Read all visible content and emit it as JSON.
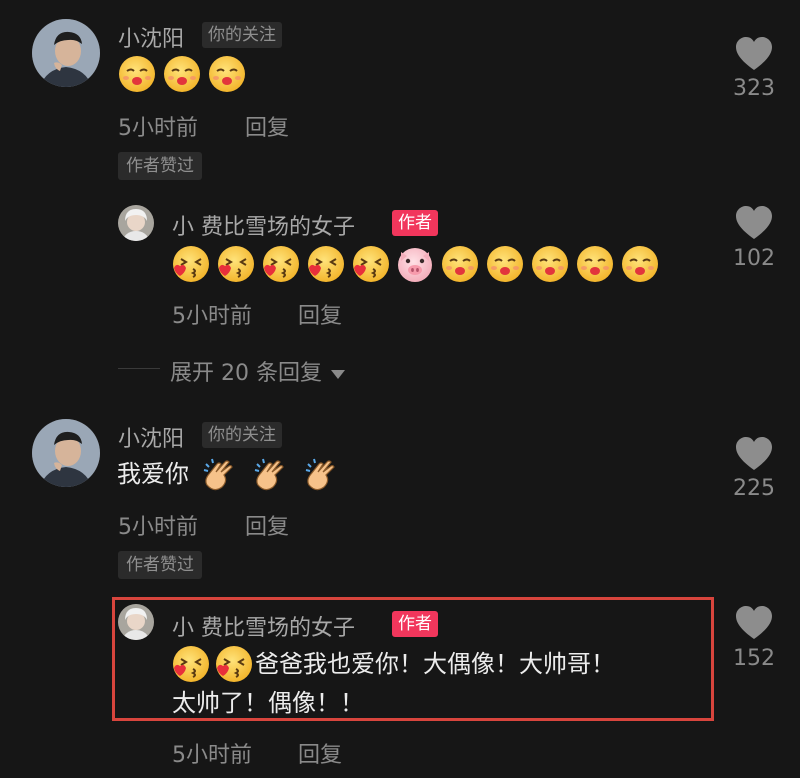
{
  "comments": [
    {
      "username": "小沈阳",
      "tag": "你的关注",
      "emojis": [
        "kiss-emoji",
        "kiss-emoji",
        "kiss-emoji"
      ],
      "time": "5小时前",
      "reply_label": "回复",
      "author_liked": "作者赞过",
      "likes": "323",
      "reply": {
        "username": "小 费比雪场的女子",
        "tag": "作者",
        "emojis": [
          "blow-kiss-emoji",
          "blow-kiss-emoji",
          "blow-kiss-emoji",
          "blow-kiss-emoji",
          "blow-kiss-emoji",
          "pig-emoji",
          "kiss-emoji",
          "kiss-emoji",
          "kiss-emoji",
          "kiss-emoji",
          "kiss-emoji"
        ],
        "time": "5小时前",
        "reply_label": "回复",
        "likes": "102"
      },
      "expand_label": "展开 20 条回复"
    },
    {
      "username": "小沈阳",
      "tag": "你的关注",
      "text": "我爱你",
      "emojis": [
        "clap-emoji",
        "clap-emoji",
        "clap-emoji"
      ],
      "time": "5小时前",
      "reply_label": "回复",
      "author_liked": "作者赞过",
      "likes": "225",
      "reply": {
        "username": "小 费比雪场的女子",
        "tag": "作者",
        "emojis": [
          "blow-kiss-emoji",
          "blow-kiss-emoji"
        ],
        "text_line1": "爸爸我也爱你！大偶像！大帅哥！",
        "text_line2": "太帅了！偶像！！",
        "time": "5小时前",
        "reply_label": "回复",
        "likes": "152"
      }
    }
  ],
  "colors": {
    "background": "#161616",
    "author_tag": "#f1365c",
    "highlight_border": "#d8453d"
  }
}
